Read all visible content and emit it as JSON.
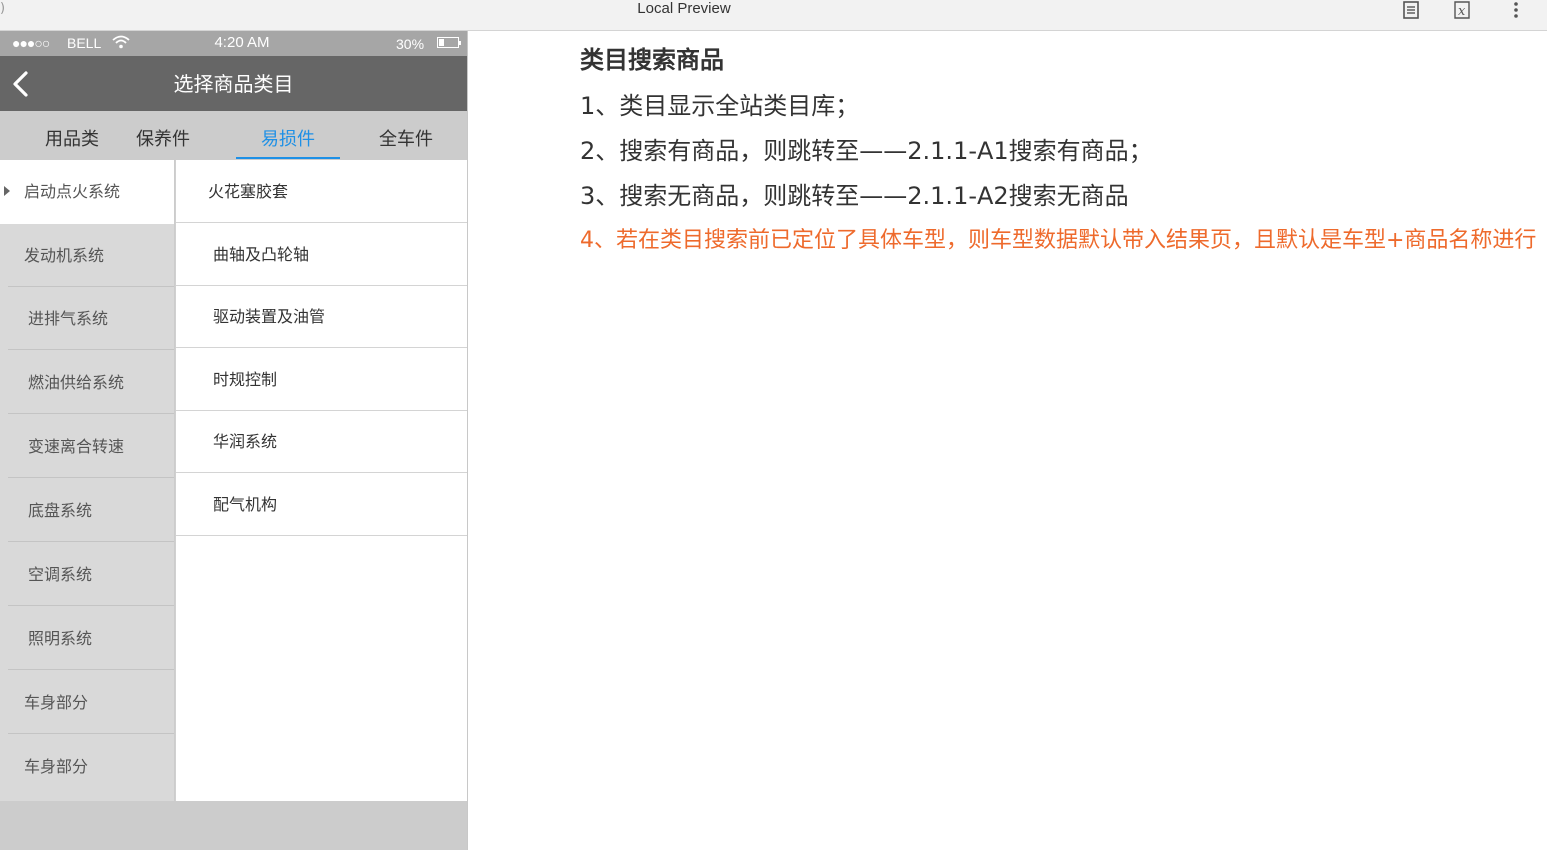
{
  "window": {
    "edge_glyph": ")",
    "title": "Local Preview",
    "icons": [
      "document-icon",
      "formula-icon",
      "more-vertical-icon"
    ]
  },
  "status_bar": {
    "signal": "●●●○○",
    "carrier": "BELL",
    "time": "4:20 AM",
    "battery": "30%"
  },
  "nav": {
    "title": "选择商品类目"
  },
  "tabs": [
    {
      "label": "用品类"
    },
    {
      "label": "保养件"
    },
    {
      "label": "易损件"
    },
    {
      "label": "全车件"
    }
  ],
  "active_tab": "易损件",
  "categories": [
    {
      "label": "启动点火系统"
    },
    {
      "label": "发动机系统"
    },
    {
      "label": "进排气系统"
    },
    {
      "label": "燃油供给系统"
    },
    {
      "label": "变速离合转速"
    },
    {
      "label": "底盘系统"
    },
    {
      "label": "空调系统"
    },
    {
      "label": "照明系统"
    },
    {
      "label": "车身部分"
    },
    {
      "label": "车身部分"
    }
  ],
  "active_category": "启动点火系统",
  "subcategories": [
    {
      "label": "火花塞胶套"
    },
    {
      "label": "曲轴及凸轮轴"
    },
    {
      "label": "驱动装置及油管"
    },
    {
      "label": "时规控制"
    },
    {
      "label": "华润系统"
    },
    {
      "label": "配气机构"
    }
  ],
  "notes": {
    "heading": "类目搜索商品",
    "lines": [
      "1、类目显示全站类目库；",
      "2、搜索有商品，则跳转至——2.1.1-A1搜索有商品；",
      "3、搜索无商品，则跳转至——2.1.1-A2搜索无商品",
      "4、若在类目搜索前已定位了具体车型，则车型数据默认带入结果页，且默认是车型+商品名称进行"
    ],
    "highlight_color": "#ee6a2c"
  },
  "colors": {
    "accent": "#1e90e6",
    "nav_bg": "#666666",
    "status_bg": "#a6a6a6"
  }
}
